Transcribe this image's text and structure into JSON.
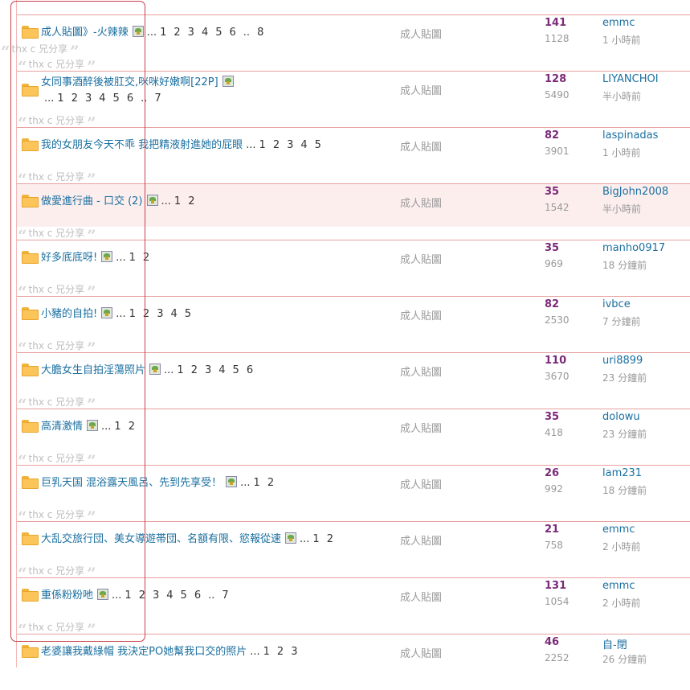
{
  "preview_top": "thx c 兄分享",
  "threads": [
    {
      "title": "成人貼圖》-火辣辣",
      "has_image": true,
      "pages": [
        "1",
        "2",
        "3",
        "4",
        "5",
        "6"
      ],
      "last_page": "8",
      "dots": "...",
      "sep": "..",
      "forum": "成人貼圖",
      "replies": "141",
      "views": "1128",
      "author": "emmc",
      "time": "1 小時前",
      "preview": "thx c 兄分享",
      "highlighted": false
    },
    {
      "title": "女同事酒醉後被肛交,咪咪好嫩啊[22P]",
      "has_image": true,
      "wrap": true,
      "pages": [
        "1",
        "2",
        "3",
        "4",
        "5",
        "6"
      ],
      "last_page": "7",
      "dots": "...",
      "sep": "..",
      "forum": "成人貼圖",
      "replies": "128",
      "views": "5490",
      "author": "LIYANCHOI",
      "time": "半小時前",
      "preview": "thx c 兄分享",
      "highlighted": false
    },
    {
      "title": "我的女朋友今天不乖 我把精液射進她的屁眼",
      "has_image": false,
      "pages": [
        "1",
        "2",
        "3",
        "4",
        "5"
      ],
      "last_page": "",
      "dots": "...",
      "sep": "",
      "forum": "成人貼圖",
      "replies": "82",
      "views": "3901",
      "author": "laspinadas",
      "time": "1 小時前",
      "preview": "thx c 兄分享",
      "highlighted": false
    },
    {
      "title": "做愛進行曲 - 口交 (2)",
      "has_image": true,
      "pages": [
        "1",
        "2"
      ],
      "last_page": "",
      "dots": "...",
      "sep": "",
      "forum": "成人貼圖",
      "replies": "35",
      "views": "1542",
      "author": "BigJohn2008",
      "time": "半小時前",
      "preview": "thx c 兄分享",
      "highlighted": true
    },
    {
      "title": "好多底底呀!",
      "has_image": true,
      "pages": [
        "1",
        "2"
      ],
      "last_page": "",
      "dots": "...",
      "sep": "",
      "forum": "成人貼圖",
      "replies": "35",
      "views": "969",
      "author": "manho0917",
      "time": "18 分鐘前",
      "preview": "thx c 兄分享",
      "highlighted": false
    },
    {
      "title": "小豬的自拍!",
      "has_image": true,
      "pages": [
        "1",
        "2",
        "3",
        "4",
        "5"
      ],
      "last_page": "",
      "dots": "...",
      "sep": "",
      "forum": "成人貼圖",
      "replies": "82",
      "views": "2530",
      "author": "ivbce",
      "time": "7 分鐘前",
      "preview": "thx c 兄分享",
      "highlighted": false
    },
    {
      "title": "大膽女生自拍淫蕩照片",
      "has_image": true,
      "pages": [
        "1",
        "2",
        "3",
        "4",
        "5",
        "6"
      ],
      "last_page": "",
      "dots": "...",
      "sep": "",
      "forum": "成人貼圖",
      "replies": "110",
      "views": "3670",
      "author": "uri8899",
      "time": "23 分鐘前",
      "preview": "thx c 兄分享",
      "highlighted": false
    },
    {
      "title": "高清激情",
      "has_image": true,
      "pages": [
        "1",
        "2"
      ],
      "last_page": "",
      "dots": "...",
      "sep": "",
      "forum": "成人貼圖",
      "replies": "35",
      "views": "418",
      "author": "dolowu",
      "time": "23 分鐘前",
      "preview": "thx c 兄分享",
      "highlighted": false
    },
    {
      "title": "巨乳天国 混浴露天風呂、先到先享受！",
      "has_image": true,
      "pages": [
        "1",
        "2"
      ],
      "last_page": "",
      "dots": "...",
      "sep": "",
      "forum": "成人貼圖",
      "replies": "26",
      "views": "992",
      "author": "lam231",
      "time": "18 分鐘前",
      "preview": "thx c 兄分享",
      "highlighted": false
    },
    {
      "title": "大乱交旅行団、美女導遊帯団、名額有限、慾報從速",
      "has_image": true,
      "pages": [
        "1",
        "2"
      ],
      "last_page": "",
      "dots": "...",
      "sep": "",
      "forum": "成人貼圖",
      "replies": "21",
      "views": "758",
      "author": "emmc",
      "time": "2 小時前",
      "preview": "thx c 兄分享",
      "highlighted": false
    },
    {
      "title": "重係粉粉吔",
      "has_image": true,
      "pages": [
        "1",
        "2",
        "3",
        "4",
        "5",
        "6"
      ],
      "last_page": "7",
      "dots": "...",
      "sep": "..",
      "forum": "成人貼圖",
      "replies": "131",
      "views": "1054",
      "author": "emmc",
      "time": "2 小時前",
      "preview": "thx c 兄分享",
      "highlighted": false
    },
    {
      "title": "老婆讓我戴綠帽 我決定PO她幫我口交的照片",
      "has_image": false,
      "pages": [
        "1",
        "2",
        "3"
      ],
      "last_page": "",
      "dots": "...",
      "sep": "",
      "forum": "成人貼圖",
      "replies": "46",
      "views": "2252",
      "author": "自-閉",
      "time": "26 分鐘前",
      "preview": "",
      "highlighted": false
    }
  ],
  "colors": {
    "link": "#1a6fa0",
    "replies": "#7a2a78",
    "row_border": "#e8a0a0",
    "highlight_row": "#fdeeee",
    "circle_outline": "#c8404a"
  }
}
